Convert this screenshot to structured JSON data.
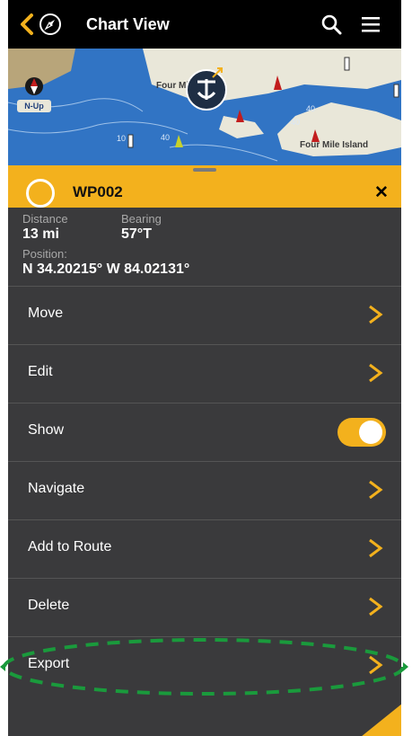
{
  "header": {
    "title": "Chart View"
  },
  "map": {
    "labels": [
      "Four Mile Neck",
      "Four Mile Island"
    ],
    "orientation_label": "N-Up",
    "depth_numbers": [
      "10",
      "40",
      "40",
      "40"
    ]
  },
  "waypoint": {
    "name": "WP002",
    "distance_label": "Distance",
    "distance_value": "13 mi",
    "bearing_label": "Bearing",
    "bearing_value": "57°T",
    "position_label": "Position:",
    "position_value": "N 34.20215° W 84.02131°"
  },
  "menu_items": [
    {
      "label": "Move"
    },
    {
      "label": "Edit"
    },
    {
      "label": "Show",
      "toggle_on": true
    },
    {
      "label": "Navigate"
    },
    {
      "label": "Add to Route"
    },
    {
      "label": "Delete"
    },
    {
      "label": "Export"
    }
  ],
  "colors": {
    "accent": "#f3b11d",
    "panel": "#3a3a3c",
    "highlight": "#1a9a3c"
  },
  "icons": [
    "back-chevron-icon",
    "compass-icon",
    "search-icon",
    "hamburger-menu-icon",
    "close-icon",
    "chevron-right-icon",
    "north-up-compass-icon",
    "anchor-icon"
  ]
}
